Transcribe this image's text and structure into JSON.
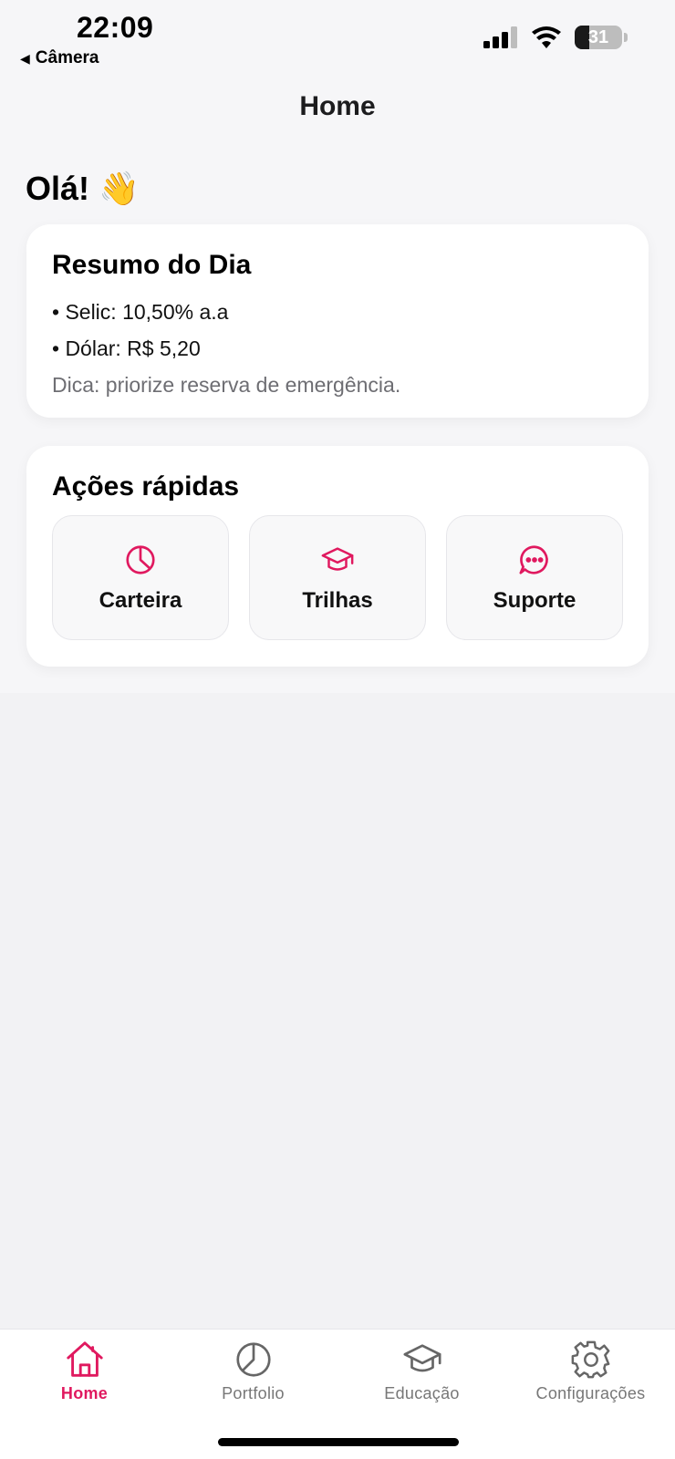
{
  "status_bar": {
    "time": "22:09",
    "back_label": "Câmera",
    "battery_level": "31",
    "battery_fraction": 0.31
  },
  "nav": {
    "title": "Home"
  },
  "greeting": {
    "text": "Olá!",
    "emoji": "👋"
  },
  "resumo": {
    "title": "Resumo do Dia",
    "items": [
      "• Selic: 10,50% a.a",
      "• Dólar: R$ 5,20"
    ],
    "tip": "Dica: priorize reserva de emergência."
  },
  "acoes": {
    "title": "Ações rápidas",
    "buttons": [
      {
        "label": "Carteira",
        "icon": "pie-chart-icon"
      },
      {
        "label": "Trilhas",
        "icon": "graduation-cap-icon"
      },
      {
        "label": "Suporte",
        "icon": "chat-bubble-icon"
      }
    ]
  },
  "tabbar": {
    "tabs": [
      {
        "label": "Home",
        "icon": "home-icon",
        "active": true
      },
      {
        "label": "Portfolio",
        "icon": "pie-chart-icon",
        "active": false
      },
      {
        "label": "Educação",
        "icon": "graduation-cap-icon",
        "active": false
      },
      {
        "label": "Configurações",
        "icon": "gear-icon",
        "active": false
      }
    ]
  },
  "colors": {
    "accent": "#e0195f",
    "inactive": "#777777",
    "background": "#f2f2f4"
  }
}
